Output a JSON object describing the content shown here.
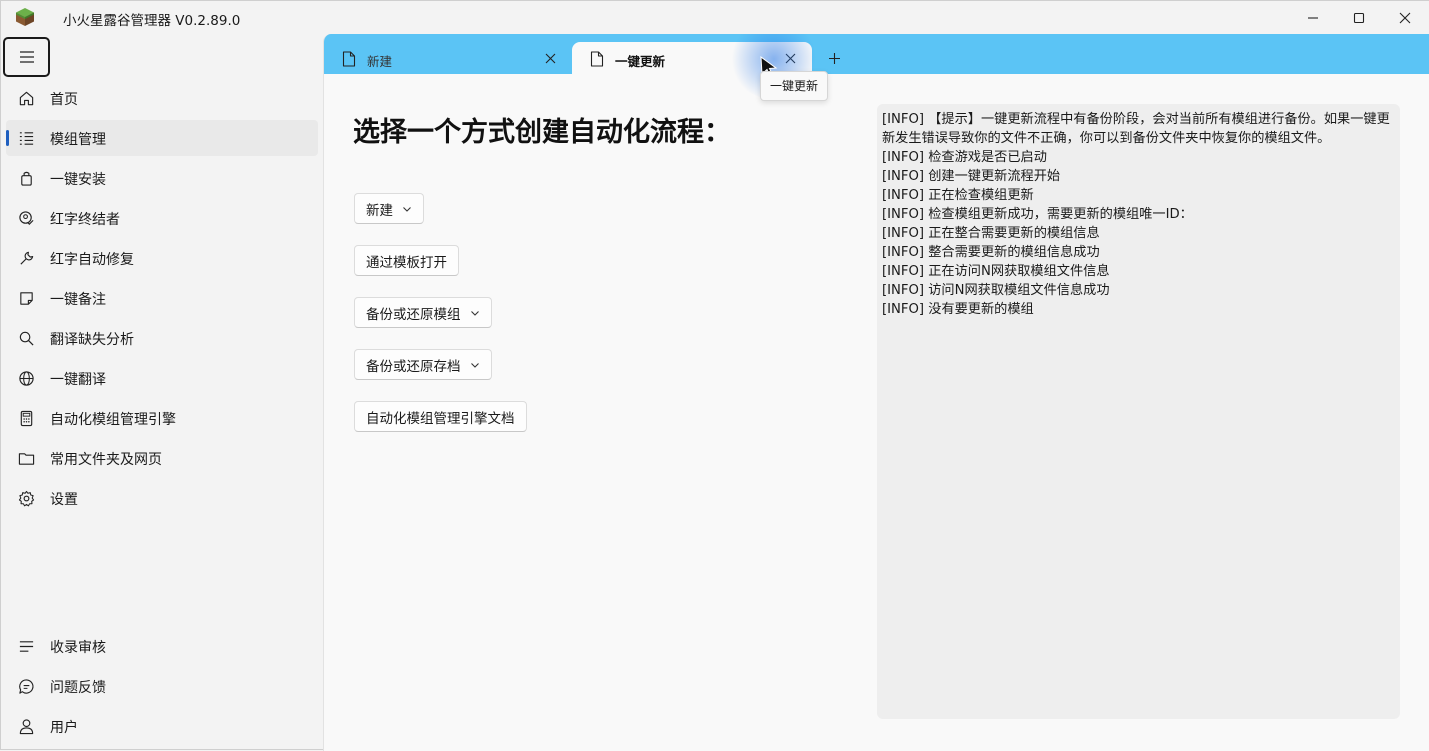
{
  "window": {
    "title": "小火星露谷管理器 V0.2.89.0",
    "icon": "grass-block-icon"
  },
  "sidebar": {
    "menu_icon": "hamburger-menu-icon",
    "items": [
      {
        "label": "首页",
        "icon": "home-icon"
      },
      {
        "label": "模组管理",
        "icon": "list-icon",
        "active": true
      },
      {
        "label": "一键安装",
        "icon": "bag-icon"
      },
      {
        "label": "红字终结者",
        "icon": "checkmark-person-icon"
      },
      {
        "label": "红字自动修复",
        "icon": "wrench-icon"
      },
      {
        "label": "一键备注",
        "icon": "note-icon"
      },
      {
        "label": "翻译缺失分析",
        "icon": "search-icon"
      },
      {
        "label": "一键翻译",
        "icon": "globe-icon"
      },
      {
        "label": "自动化模组管理引擎",
        "icon": "calculator-icon"
      },
      {
        "label": "常用文件夹及网页",
        "icon": "folder-icon"
      },
      {
        "label": "设置",
        "icon": "gear-icon"
      }
    ],
    "footer_items": [
      {
        "label": "收录审核",
        "icon": "lines-icon"
      },
      {
        "label": "问题反馈",
        "icon": "chat-icon"
      },
      {
        "label": "用户",
        "icon": "person-icon"
      }
    ]
  },
  "tabs": [
    {
      "label": "新建",
      "active": false
    },
    {
      "label": "一键更新",
      "active": true
    }
  ],
  "tooltip": "一键更新",
  "main": {
    "heading": "选择一个方式创建自动化流程：",
    "buttons": [
      {
        "label": "新建",
        "dropdown": true
      },
      {
        "label": "通过模板打开",
        "dropdown": false
      },
      {
        "label": "备份或还原模组",
        "dropdown": true
      },
      {
        "label": "备份或还原存档",
        "dropdown": true
      },
      {
        "label": "自动化模组管理引擎文档",
        "dropdown": false
      }
    ]
  },
  "log": [
    "[INFO] 【提示】一键更新流程中有备份阶段，会对当前所有模组进行备份。如果一键更新发生错误导致你的文件不正确，你可以到备份文件夹中恢复你的模组文件。",
    "[INFO] 检查游戏是否已启动",
    "[INFO] 创建一键更新流程开始",
    "[INFO] 正在检查模组更新",
    "[INFO] 检查模组更新成功，需要更新的模组唯一ID：",
    "[INFO] 正在整合需要更新的模组信息",
    "[INFO] 整合需要更新的模组信息成功",
    "[INFO] 正在访问N网获取模组文件信息",
    "[INFO] 访问N网获取模组文件信息成功",
    "[INFO] 没有要更新的模组"
  ],
  "colors": {
    "tab_strip": "#5bc4f5",
    "nav_indicator": "#1f5fbf",
    "window_bg": "#f3f3f3",
    "content_bg": "#f9f9f9",
    "log_bg": "#eeeeee"
  }
}
